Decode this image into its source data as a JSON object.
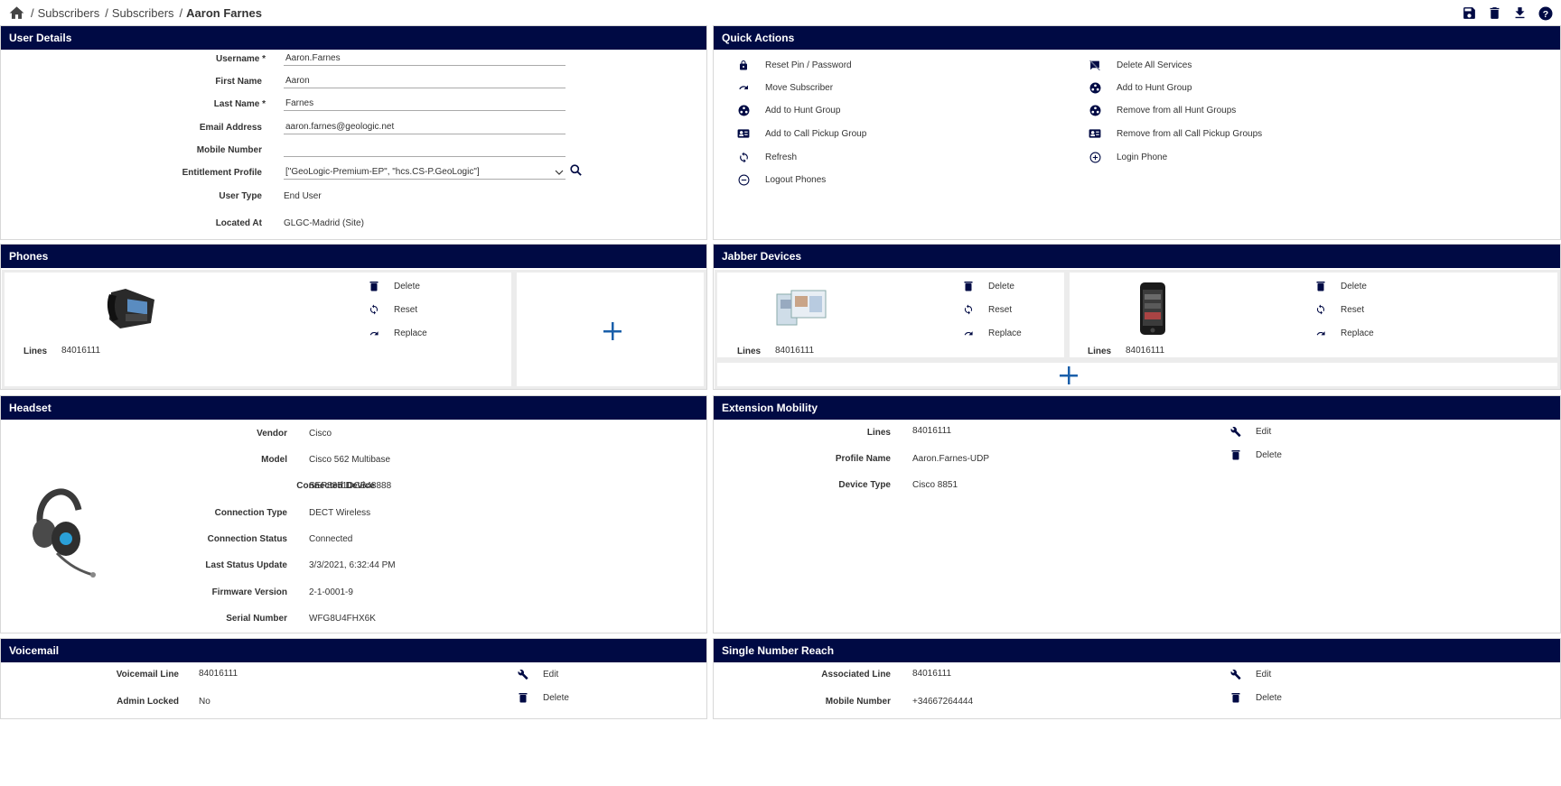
{
  "breadcrumb": {
    "items": [
      "Subscribers",
      "Subscribers"
    ],
    "current": "Aaron Farnes"
  },
  "user_details": {
    "title": "User Details",
    "username_label": "Username *",
    "username": "Aaron.Farnes",
    "first_name_label": "First Name",
    "first_name": "Aaron",
    "last_name_label": "Last Name *",
    "last_name": "Farnes",
    "email_label": "Email Address",
    "email": "aaron.farnes@geologic.net",
    "mobile_label": "Mobile Number",
    "mobile": "",
    "entitlement_label": "Entitlement Profile",
    "entitlement": "[\"GeoLogic-Premium-EP\", \"hcs.CS-P.GeoLogic\"]",
    "user_type_label": "User Type",
    "user_type": "End User",
    "located_label": "Located At",
    "located": "GLGC-Madrid (Site)"
  },
  "quick_actions": {
    "title": "Quick Actions",
    "left": [
      "Reset Pin / Password",
      "Move Subscriber",
      "Add to Hunt Group",
      "Add to Call Pickup Group",
      "Refresh",
      "Logout Phones"
    ],
    "right": [
      "Delete All Services",
      "Add to Hunt Group",
      "Remove from all Hunt Groups",
      "Remove from all Call Pickup Groups",
      "Login Phone"
    ]
  },
  "phones": {
    "title": "Phones",
    "lines_label": "Lines",
    "lines": "84016111",
    "actions": [
      "Delete",
      "Reset",
      "Replace"
    ]
  },
  "jabber": {
    "title": "Jabber Devices",
    "devices": [
      {
        "lines_label": "Lines",
        "lines": "84016111",
        "actions": [
          "Delete",
          "Reset",
          "Replace"
        ]
      },
      {
        "lines_label": "Lines",
        "lines": "84016111",
        "actions": [
          "Delete",
          "Reset",
          "Replace"
        ]
      }
    ]
  },
  "headset": {
    "title": "Headset",
    "vendor_label": "Vendor",
    "vendor": "Cisco",
    "model_label": "Model",
    "model": "Cisco 562 Multibase",
    "device_label": "Connected Device",
    "device": "SEP8851DCB48888",
    "conn_type_label": "Connection Type",
    "conn_type": "DECT Wireless",
    "status_label": "Connection Status",
    "status": "Connected",
    "last_update_label": "Last Status Update",
    "last_update": "3/3/2021, 6:32:44 PM",
    "firmware_label": "Firmware Version",
    "firmware": "2-1-0001-9",
    "serial_label": "Serial Number",
    "serial": "WFG8U4FHX6K"
  },
  "extension_mobility": {
    "title": "Extension Mobility",
    "lines_label": "Lines",
    "lines": "84016111",
    "profile_label": "Profile Name",
    "profile": "Aaron.Farnes-UDP",
    "device_type_label": "Device Type",
    "device_type": "Cisco 8851",
    "edit": "Edit",
    "delete": "Delete"
  },
  "voicemail": {
    "title": "Voicemail",
    "line_label": "Voicemail Line",
    "line": "84016111",
    "locked_label": "Admin Locked",
    "locked": "No",
    "edit": "Edit",
    "delete": "Delete"
  },
  "snr": {
    "title": "Single Number Reach",
    "line_label": "Associated Line",
    "line": "84016111",
    "mobile_label": "Mobile Number",
    "mobile": "+34667264444",
    "edit": "Edit",
    "delete": "Delete"
  },
  "colors": {
    "header_bg": "#000a44",
    "icon": "#000a44",
    "plus": "#1a5faa"
  }
}
